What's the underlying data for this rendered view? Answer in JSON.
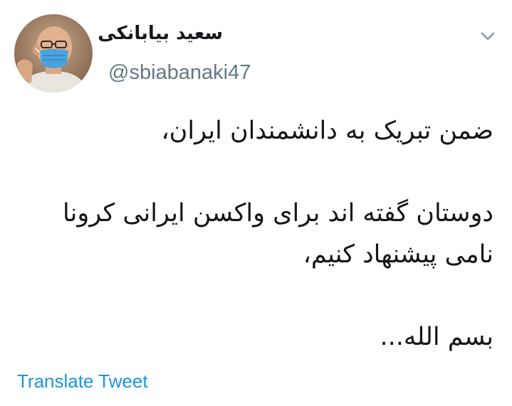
{
  "user": {
    "display_name": "سعید بیابانکی",
    "handle": "@sbiabanaki47",
    "avatar_icon": "user-avatar-masked"
  },
  "tweet": {
    "lines": [
      "ضمن تبریک به دانشمندان ایران،",
      "",
      "دوستان گفته اند برای واکسن ایرانی کرونا",
      "نامی پیشنهاد کنیم،",
      "",
      "بسم الله..."
    ]
  },
  "actions": {
    "translate_label": "Translate Tweet",
    "more_icon": "chevron-down-icon"
  },
  "colors": {
    "link": "#1b95e0",
    "secondary_text": "#657786",
    "text": "#14171a"
  }
}
